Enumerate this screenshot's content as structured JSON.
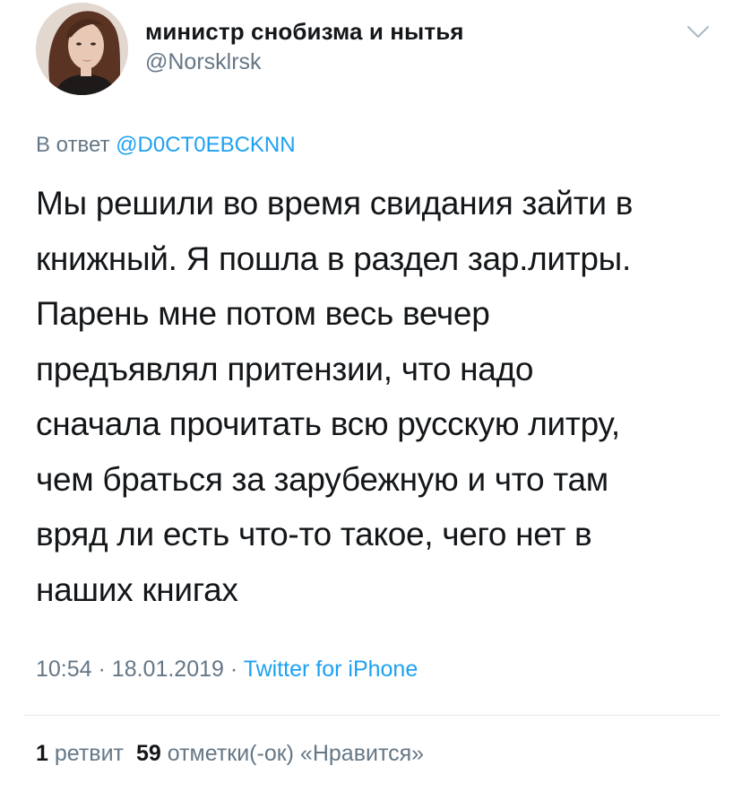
{
  "author": {
    "display_name": "министр снобизма и нытья",
    "handle": "@Norsklrsk",
    "avatar_icon": "profile-photo"
  },
  "menu": {
    "icon": "chevron-down-icon"
  },
  "reply": {
    "prefix": "В ответ",
    "mention": "@D0CT0EBCKNN"
  },
  "tweet": {
    "text": "Мы решили во время свидания зайти в\nкнижный. Я пошла в раздел зар.литры.\nПарень мне потом весь вечер\nпредъявлял притензии, что надо\nсначала прочитать всю русскую литру,\nчем браться за зарубежную и что там\nвряд ли есть что-то такое, чего нет в\nнаших книгах"
  },
  "meta": {
    "time": "10:54",
    "separator": "·",
    "date": "18.01.2019",
    "source": "Twitter for iPhone"
  },
  "stats": {
    "retweets_count": "1",
    "retweets_label": "ретвит",
    "likes_count": "59",
    "likes_label": "отметки(-ок) «Нравится»"
  },
  "colors": {
    "text": "#14171a",
    "secondary": "#657786",
    "link": "#1da1f2",
    "divider": "#e1e8ed"
  }
}
